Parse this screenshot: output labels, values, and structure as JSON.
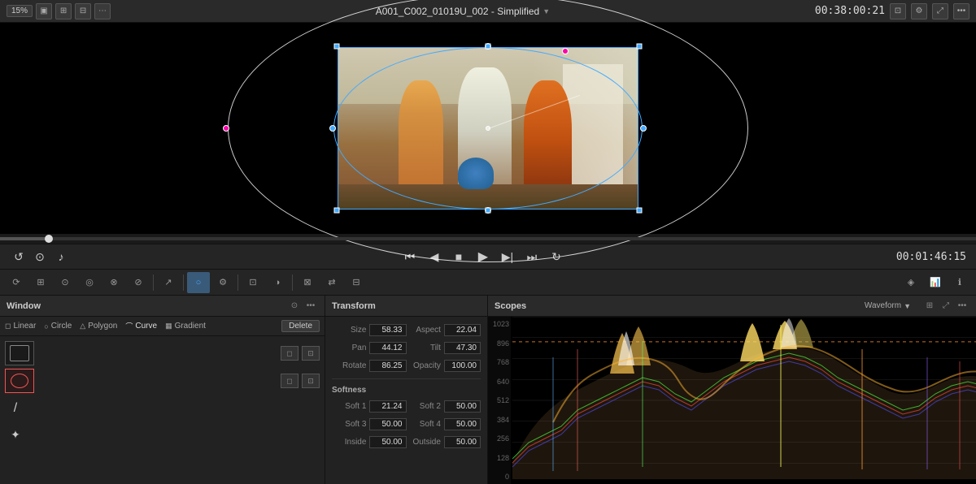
{
  "topBar": {
    "zoom": "15%",
    "title": "A001_C002_01019U_002 - Simplified",
    "timecode": "00:38:00:21",
    "icons": [
      "layout-a",
      "layout-b",
      "expand"
    ]
  },
  "transport": {
    "timecode": "00:01:46:15",
    "buttons": [
      "skip-back",
      "back",
      "stop",
      "play",
      "forward",
      "skip-forward",
      "loop"
    ]
  },
  "window": {
    "title": "Window",
    "tabs": [
      {
        "label": "Linear",
        "icon": "◻"
      },
      {
        "label": "Circle",
        "icon": "○"
      },
      {
        "label": "Polygon",
        "icon": "△"
      },
      {
        "label": "Curve",
        "icon": "⌒"
      },
      {
        "label": "Gradient",
        "icon": "▦"
      }
    ],
    "deleteBtn": "Delete"
  },
  "transform": {
    "title": "Transform",
    "fields": {
      "size": "58.33",
      "aspect": "22.04",
      "pan": "44.12",
      "tilt": "47.30",
      "rotate": "86.25",
      "opacity": "100.00"
    },
    "softness": {
      "title": "Softness",
      "soft1": "21.24",
      "soft2": "50.00",
      "soft3": "50.00",
      "soft4": "50.00",
      "inside": "50.00",
      "outside": "50.00"
    }
  },
  "scopes": {
    "title": "Scopes",
    "mode": "Waveform",
    "labels": [
      "1023",
      "896",
      "768",
      "640",
      "512",
      "384",
      "256",
      "128",
      "0"
    ]
  },
  "tools": {
    "active": "ellipse"
  }
}
